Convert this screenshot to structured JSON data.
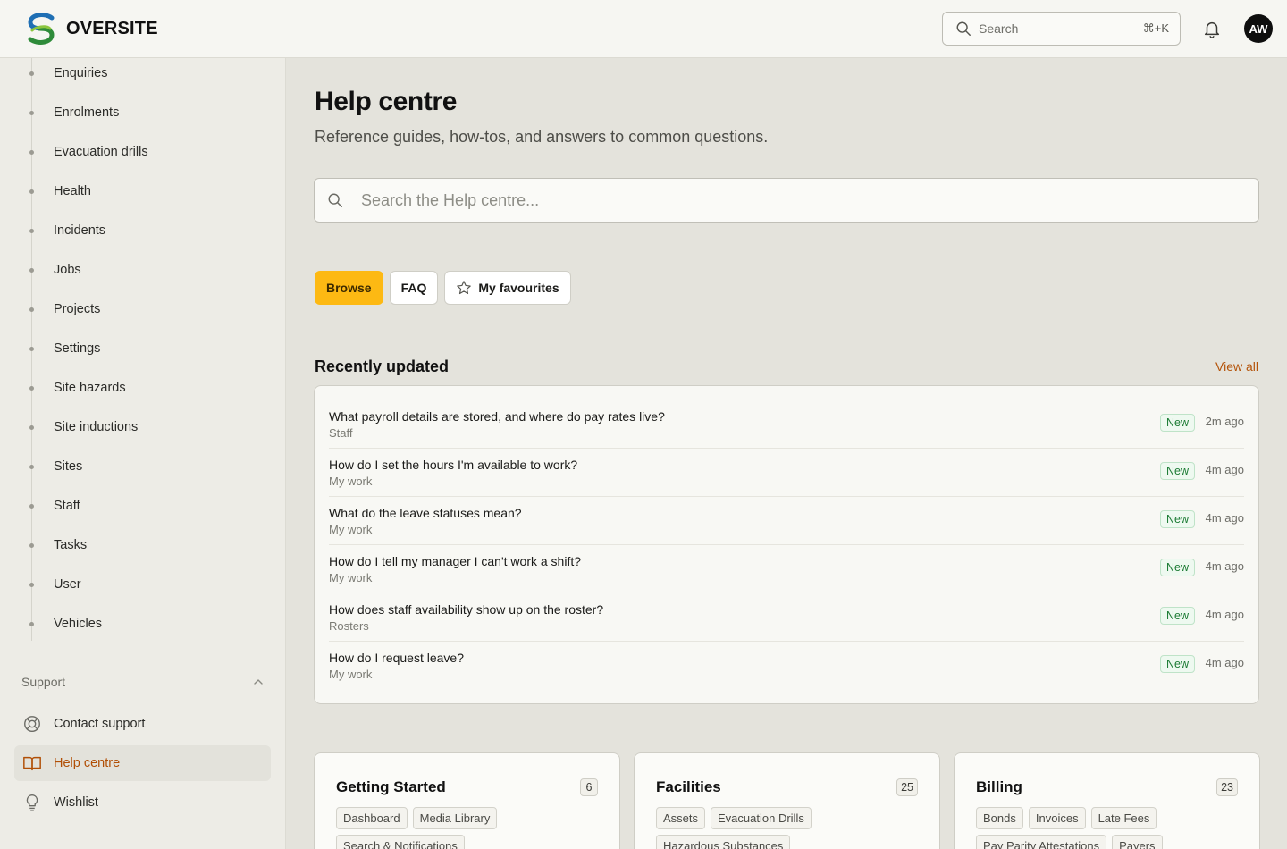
{
  "app": {
    "name": "OVERSITE"
  },
  "header": {
    "search_placeholder": "Search",
    "search_shortcut": "⌘+K",
    "avatar_initials": "AW"
  },
  "sidebar": {
    "items": [
      {
        "label": "Enquiries"
      },
      {
        "label": "Enrolments"
      },
      {
        "label": "Evacuation drills"
      },
      {
        "label": "Health"
      },
      {
        "label": "Incidents"
      },
      {
        "label": "Jobs"
      },
      {
        "label": "Projects"
      },
      {
        "label": "Settings"
      },
      {
        "label": "Site hazards"
      },
      {
        "label": "Site inductions"
      },
      {
        "label": "Sites"
      },
      {
        "label": "Staff"
      },
      {
        "label": "Tasks"
      },
      {
        "label": "User"
      },
      {
        "label": "Vehicles"
      }
    ],
    "support": {
      "heading": "Support",
      "items": [
        {
          "label": "Contact support",
          "icon": "lifebuoy-icon"
        },
        {
          "label": "Help centre",
          "icon": "book-icon",
          "active": true
        },
        {
          "label": "Wishlist",
          "icon": "lightbulb-icon"
        }
      ]
    }
  },
  "main": {
    "title": "Help centre",
    "subtitle": "Reference guides, how-tos, and answers to common questions.",
    "search_placeholder": "Search the Help centre...",
    "tabs": [
      {
        "label": "Browse",
        "active": true
      },
      {
        "label": "FAQ"
      },
      {
        "label": "My favourites",
        "icon": "star-icon"
      }
    ],
    "recent": {
      "title": "Recently updated",
      "view_all": "View all",
      "rows": [
        {
          "title": "What payroll details are stored, and where do pay rates live?",
          "category": "Staff",
          "badge": "New",
          "time": "2m ago"
        },
        {
          "title": "How do I set the hours I'm available to work?",
          "category": "My work",
          "badge": "New",
          "time": "4m ago"
        },
        {
          "title": "What do the leave statuses mean?",
          "category": "My work",
          "badge": "New",
          "time": "4m ago"
        },
        {
          "title": "How do I tell my manager I can't work a shift?",
          "category": "My work",
          "badge": "New",
          "time": "4m ago"
        },
        {
          "title": "How does staff availability show up on the roster?",
          "category": "Rosters",
          "badge": "New",
          "time": "4m ago"
        },
        {
          "title": "How do I request leave?",
          "category": "My work",
          "badge": "New",
          "time": "4m ago"
        }
      ]
    },
    "cards": [
      {
        "title": "Getting Started",
        "count": "6",
        "chips": [
          "Dashboard",
          "Media Library",
          "Search & Notifications"
        ]
      },
      {
        "title": "Facilities",
        "count": "25",
        "chips": [
          "Assets",
          "Evacuation Drills",
          "Hazardous Substances"
        ]
      },
      {
        "title": "Billing",
        "count": "23",
        "chips": [
          "Bonds",
          "Invoices",
          "Late Fees",
          "Pay Parity Attestations",
          "Payers"
        ]
      }
    ]
  },
  "colors": {
    "accent": "#fdb913",
    "link": "#b4540a",
    "active_nav": "#b14f06",
    "badge_green": "#1c7b34"
  }
}
